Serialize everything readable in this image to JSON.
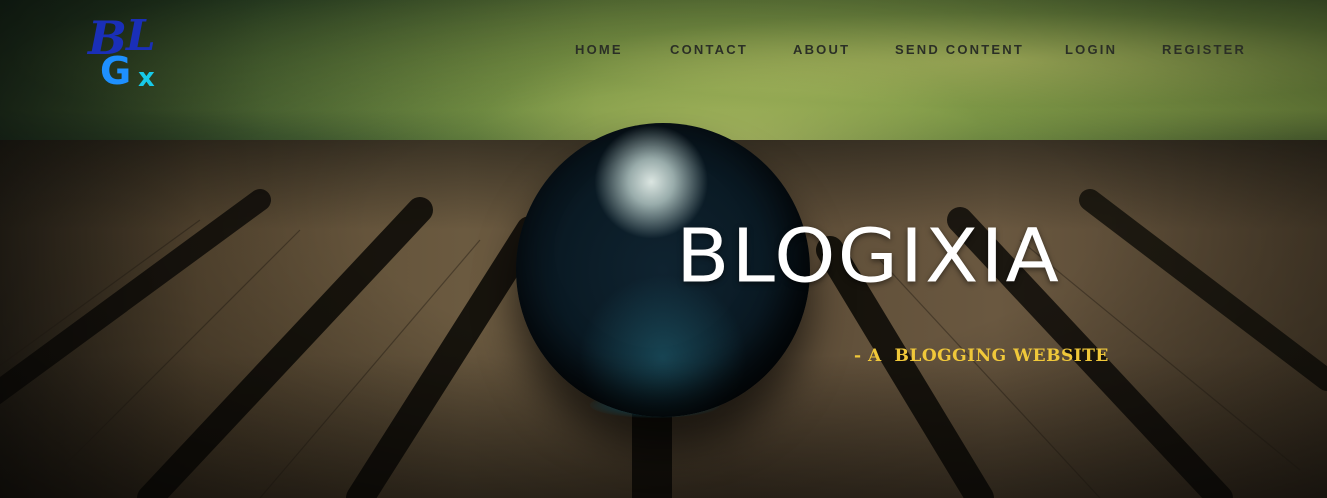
{
  "brand": {
    "logo_alt": "BLGx",
    "logo_letters": [
      "B",
      "L",
      "G",
      "x"
    ],
    "title": "BLOGIXIA",
    "tagline": "- A  BLOGGING WEBSITE"
  },
  "nav": {
    "items": [
      {
        "label": "HOME"
      },
      {
        "label": "CONTACT"
      },
      {
        "label": "ABOUT"
      },
      {
        "label": "SEND CONTENT"
      },
      {
        "label": "LOGIN"
      },
      {
        "label": "REGISTER"
      }
    ]
  },
  "colors": {
    "nav_text": "#2b2f26",
    "title": "#ffffff",
    "tagline": "#f0c83a",
    "logo_dark_blue": "#1a2fb8",
    "logo_light_blue": "#1e90ff",
    "logo_cyan": "#18c9e8"
  }
}
